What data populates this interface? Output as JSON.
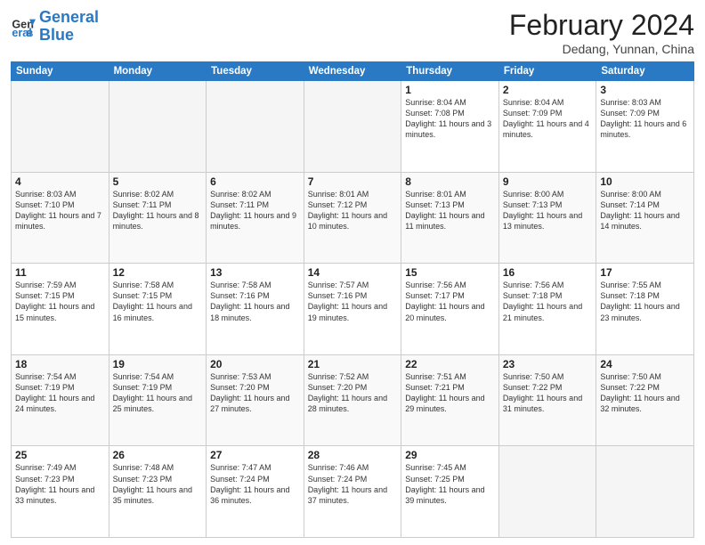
{
  "header": {
    "logo_line1": "General",
    "logo_line2": "Blue",
    "month_title": "February 2024",
    "subtitle": "Dedang, Yunnan, China"
  },
  "days_of_week": [
    "Sunday",
    "Monday",
    "Tuesday",
    "Wednesday",
    "Thursday",
    "Friday",
    "Saturday"
  ],
  "weeks": [
    [
      {
        "day": "",
        "info": ""
      },
      {
        "day": "",
        "info": ""
      },
      {
        "day": "",
        "info": ""
      },
      {
        "day": "",
        "info": ""
      },
      {
        "day": "1",
        "info": "Sunrise: 8:04 AM\nSunset: 7:08 PM\nDaylight: 11 hours\nand 3 minutes."
      },
      {
        "day": "2",
        "info": "Sunrise: 8:04 AM\nSunset: 7:09 PM\nDaylight: 11 hours\nand 4 minutes."
      },
      {
        "day": "3",
        "info": "Sunrise: 8:03 AM\nSunset: 7:09 PM\nDaylight: 11 hours\nand 6 minutes."
      }
    ],
    [
      {
        "day": "4",
        "info": "Sunrise: 8:03 AM\nSunset: 7:10 PM\nDaylight: 11 hours\nand 7 minutes."
      },
      {
        "day": "5",
        "info": "Sunrise: 8:02 AM\nSunset: 7:11 PM\nDaylight: 11 hours\nand 8 minutes."
      },
      {
        "day": "6",
        "info": "Sunrise: 8:02 AM\nSunset: 7:11 PM\nDaylight: 11 hours\nand 9 minutes."
      },
      {
        "day": "7",
        "info": "Sunrise: 8:01 AM\nSunset: 7:12 PM\nDaylight: 11 hours\nand 10 minutes."
      },
      {
        "day": "8",
        "info": "Sunrise: 8:01 AM\nSunset: 7:13 PM\nDaylight: 11 hours\nand 11 minutes."
      },
      {
        "day": "9",
        "info": "Sunrise: 8:00 AM\nSunset: 7:13 PM\nDaylight: 11 hours\nand 13 minutes."
      },
      {
        "day": "10",
        "info": "Sunrise: 8:00 AM\nSunset: 7:14 PM\nDaylight: 11 hours\nand 14 minutes."
      }
    ],
    [
      {
        "day": "11",
        "info": "Sunrise: 7:59 AM\nSunset: 7:15 PM\nDaylight: 11 hours\nand 15 minutes."
      },
      {
        "day": "12",
        "info": "Sunrise: 7:58 AM\nSunset: 7:15 PM\nDaylight: 11 hours\nand 16 minutes."
      },
      {
        "day": "13",
        "info": "Sunrise: 7:58 AM\nSunset: 7:16 PM\nDaylight: 11 hours\nand 18 minutes."
      },
      {
        "day": "14",
        "info": "Sunrise: 7:57 AM\nSunset: 7:16 PM\nDaylight: 11 hours\nand 19 minutes."
      },
      {
        "day": "15",
        "info": "Sunrise: 7:56 AM\nSunset: 7:17 PM\nDaylight: 11 hours\nand 20 minutes."
      },
      {
        "day": "16",
        "info": "Sunrise: 7:56 AM\nSunset: 7:18 PM\nDaylight: 11 hours\nand 21 minutes."
      },
      {
        "day": "17",
        "info": "Sunrise: 7:55 AM\nSunset: 7:18 PM\nDaylight: 11 hours\nand 23 minutes."
      }
    ],
    [
      {
        "day": "18",
        "info": "Sunrise: 7:54 AM\nSunset: 7:19 PM\nDaylight: 11 hours\nand 24 minutes."
      },
      {
        "day": "19",
        "info": "Sunrise: 7:54 AM\nSunset: 7:19 PM\nDaylight: 11 hours\nand 25 minutes."
      },
      {
        "day": "20",
        "info": "Sunrise: 7:53 AM\nSunset: 7:20 PM\nDaylight: 11 hours\nand 27 minutes."
      },
      {
        "day": "21",
        "info": "Sunrise: 7:52 AM\nSunset: 7:20 PM\nDaylight: 11 hours\nand 28 minutes."
      },
      {
        "day": "22",
        "info": "Sunrise: 7:51 AM\nSunset: 7:21 PM\nDaylight: 11 hours\nand 29 minutes."
      },
      {
        "day": "23",
        "info": "Sunrise: 7:50 AM\nSunset: 7:22 PM\nDaylight: 11 hours\nand 31 minutes."
      },
      {
        "day": "24",
        "info": "Sunrise: 7:50 AM\nSunset: 7:22 PM\nDaylight: 11 hours\nand 32 minutes."
      }
    ],
    [
      {
        "day": "25",
        "info": "Sunrise: 7:49 AM\nSunset: 7:23 PM\nDaylight: 11 hours\nand 33 minutes."
      },
      {
        "day": "26",
        "info": "Sunrise: 7:48 AM\nSunset: 7:23 PM\nDaylight: 11 hours\nand 35 minutes."
      },
      {
        "day": "27",
        "info": "Sunrise: 7:47 AM\nSunset: 7:24 PM\nDaylight: 11 hours\nand 36 minutes."
      },
      {
        "day": "28",
        "info": "Sunrise: 7:46 AM\nSunset: 7:24 PM\nDaylight: 11 hours\nand 37 minutes."
      },
      {
        "day": "29",
        "info": "Sunrise: 7:45 AM\nSunset: 7:25 PM\nDaylight: 11 hours\nand 39 minutes."
      },
      {
        "day": "",
        "info": ""
      },
      {
        "day": "",
        "info": ""
      }
    ]
  ]
}
